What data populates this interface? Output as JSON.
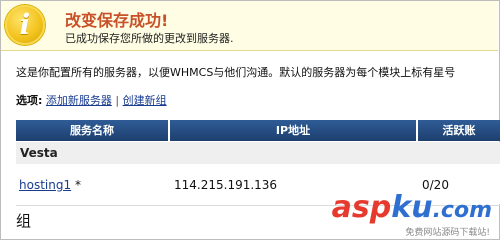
{
  "banner": {
    "icon": "info-icon",
    "icon_glyph": "i",
    "title": "改变保存成功!",
    "message": "已成功保存您所做的更改到服务器."
  },
  "description": "这是你配置所有的服务器，以便WHMCS与他们沟通。默认的服务器为每个模块上标有星号",
  "options": {
    "label": "选项:",
    "add_server": "添加新服务器",
    "separator": "|",
    "create_group": "创建新组"
  },
  "table": {
    "headers": [
      "服务名称",
      "IP地址",
      "活跃账"
    ],
    "group_name": "Vesta",
    "rows": [
      {
        "name": "hosting1",
        "default_mark": "*",
        "ip": "114.215.191.136",
        "accounts": "0/20"
      }
    ]
  },
  "section_heading": "组",
  "watermark": {
    "brand_a": "asp",
    "brand_k": "ku",
    "brand_tld": ".com",
    "tagline": "免费网站源码下载站!"
  },
  "colors": {
    "banner_bg": "#fffde4",
    "banner_title": "#c8512a",
    "header_bg": "#244a7f",
    "link": "#1a3c8f"
  }
}
